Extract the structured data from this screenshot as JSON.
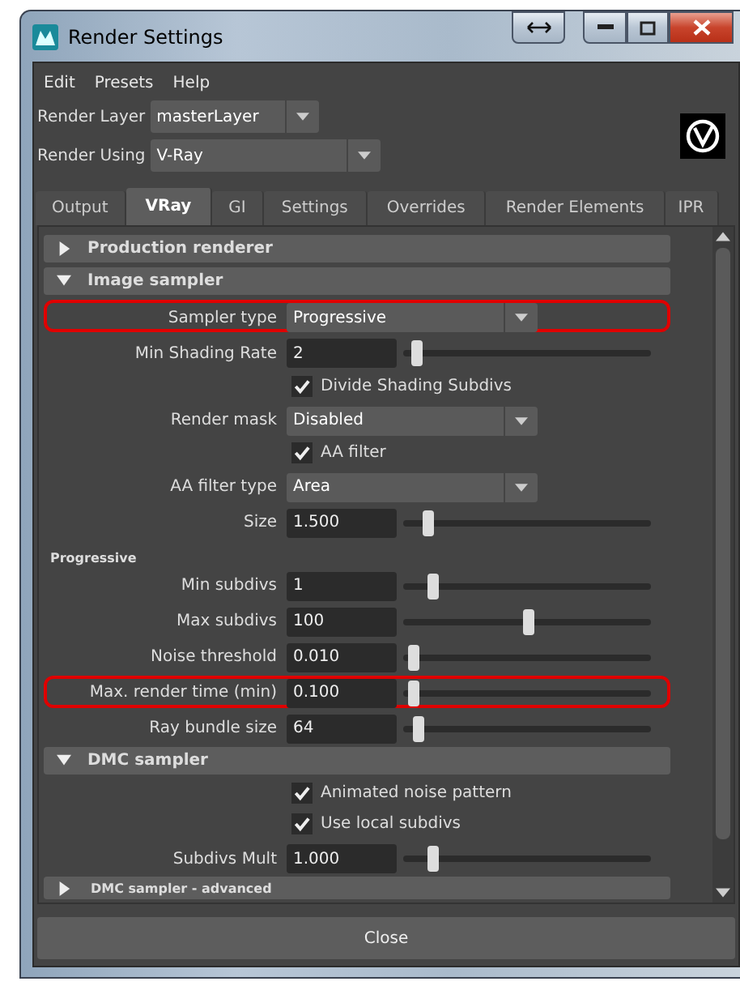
{
  "window": {
    "title": "Render Settings"
  },
  "menu": [
    "Edit",
    "Presets",
    "Help"
  ],
  "render_layer": {
    "label": "Render Layer",
    "value": "masterLayer"
  },
  "render_using": {
    "label": "Render Using",
    "value": "V-Ray"
  },
  "tabs": [
    {
      "label": "Output",
      "selected": false
    },
    {
      "label": "VRay",
      "selected": true
    },
    {
      "label": "GI",
      "selected": false
    },
    {
      "label": "Settings",
      "selected": false
    },
    {
      "label": "Overrides",
      "selected": false
    },
    {
      "label": "Render Elements",
      "selected": false
    },
    {
      "label": "IPR",
      "selected": false
    }
  ],
  "items": [
    {
      "kind": "section",
      "title": "Production renderer",
      "expanded": false
    },
    {
      "kind": "section",
      "title": "Image sampler",
      "expanded": true
    },
    {
      "kind": "dropdown",
      "label": "Sampler type",
      "value": "Progressive",
      "highlighted": true
    },
    {
      "kind": "slider",
      "label": "Min Shading Rate",
      "value": "2",
      "level": 0.05,
      "highlighted": false
    },
    {
      "kind": "checkbox",
      "label": "Divide Shading Subdivs",
      "checked": true
    },
    {
      "kind": "dropdown",
      "label": "Render mask",
      "value": "Disabled",
      "highlighted": false
    },
    {
      "kind": "checkbox",
      "label": "AA filter",
      "checked": true
    },
    {
      "kind": "dropdown",
      "label": "AA filter type",
      "value": "Area",
      "highlighted": false
    },
    {
      "kind": "slider",
      "label": "Size",
      "value": "1.500",
      "level": 0.1,
      "highlighted": false
    },
    {
      "kind": "subheading",
      "label": "Progressive"
    },
    {
      "kind": "slider",
      "label": "Min subdivs",
      "value": "1",
      "level": 0.12,
      "highlighted": false
    },
    {
      "kind": "slider",
      "label": "Max subdivs",
      "value": "100",
      "level": 0.5,
      "highlighted": false
    },
    {
      "kind": "slider",
      "label": "Noise threshold",
      "value": "0.010",
      "level": 0.04,
      "highlighted": false
    },
    {
      "kind": "slider",
      "label": "Max. render time (min)",
      "value": "0.100",
      "level": 0.04,
      "highlighted": true
    },
    {
      "kind": "slider",
      "label": "Ray bundle size",
      "value": "64",
      "level": 0.06,
      "highlighted": false
    },
    {
      "kind": "section",
      "title": "DMC sampler",
      "expanded": true
    },
    {
      "kind": "checkbox",
      "label": "Animated noise pattern",
      "checked": true
    },
    {
      "kind": "checkbox",
      "label": "Use local subdivs",
      "checked": true
    },
    {
      "kind": "slider",
      "label": "Subdivs Mult",
      "value": "1.000",
      "level": 0.12,
      "highlighted": false
    },
    {
      "kind": "subsection",
      "title": "DMC sampler - advanced",
      "expanded": false
    }
  ],
  "close_button": "Close"
}
